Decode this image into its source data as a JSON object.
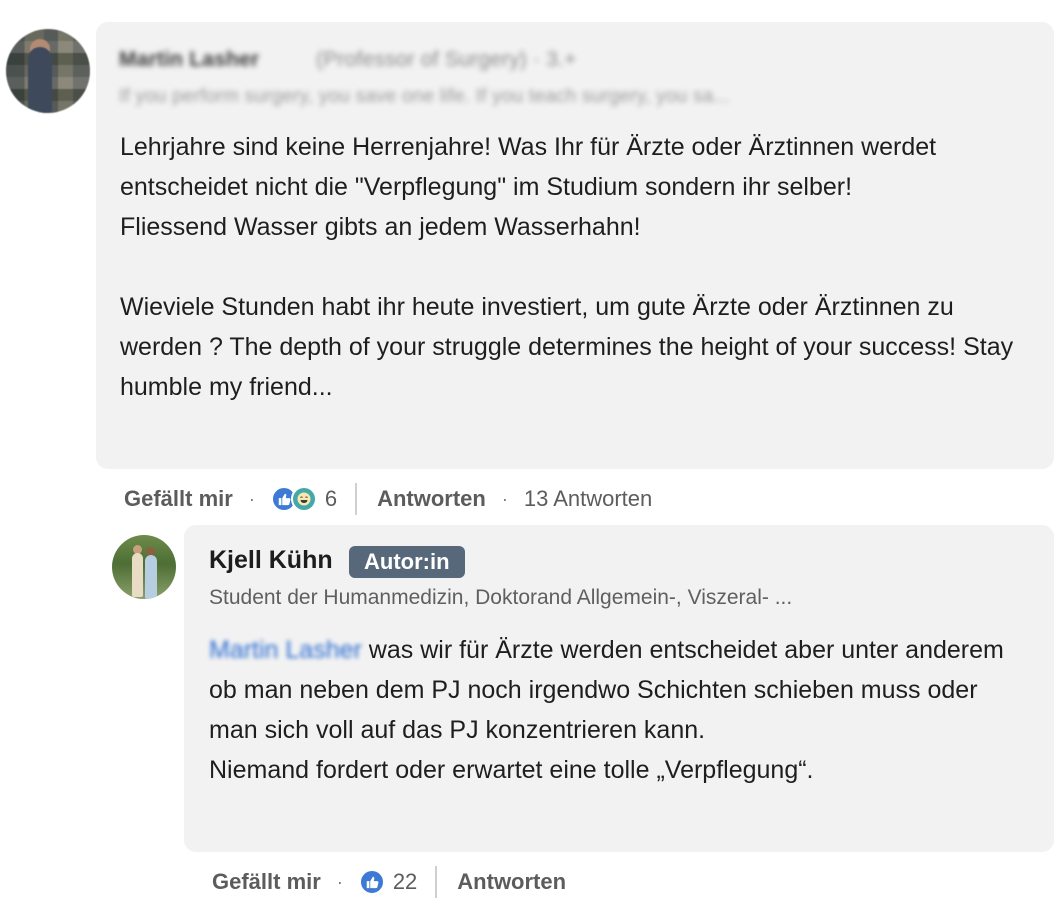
{
  "comment": {
    "author_name": "Martin Lasher",
    "author_role": "(Professor of Surgery) · 3.+",
    "author_headline": "If you perform surgery, you save one life. If you teach surgery, you sa...",
    "paragraphs": [
      "Lehrjahre sind keine Herrenjahre! Was Ihr für Ärzte oder Ärztinnen werdet entscheidet nicht die \"Verpflegung\" im Studium sondern ihr selber!",
      "Fliessend Wasser gibts an jedem Wasserhahn!",
      "Wieviele Stunden habt ihr heute investiert, um gute Ärzte oder Ärztinnen zu werden ? The depth of your struggle determines the height of your success! Stay humble my friend..."
    ],
    "actions": {
      "like_label": "Gefällt mir",
      "reaction_count": "6",
      "reply_label": "Antworten",
      "replies_count": "13 Antworten"
    }
  },
  "reply": {
    "author_name": "Kjell Kühn",
    "badge": "Autor:in",
    "author_headline": "Student der Humanmedizin, Doktorand Allgemein-, Viszeral- ...",
    "mention": "Martin Lasher",
    "line_1_after_mention": " was wir für Ärzte werden entscheidet aber unter anderem ob man neben dem PJ noch irgendwo Schichten schieben muss oder man sich voll auf das PJ konzentrieren kann.",
    "line_2": "Niemand fordert oder erwartet eine tolle „Verpflegung“.",
    "actions": {
      "like_label": "Gefällt mir",
      "reaction_count": "22",
      "reply_label": "Antworten"
    }
  },
  "icons": {
    "like": "thumbs-up-icon",
    "funny": "laughing-face-icon"
  },
  "colors": {
    "bubble": "#f2f2f2",
    "badge": "#56687a",
    "like": "#3d7ad6",
    "funny": "#44a8a8",
    "mention": "#2a6bd1"
  }
}
